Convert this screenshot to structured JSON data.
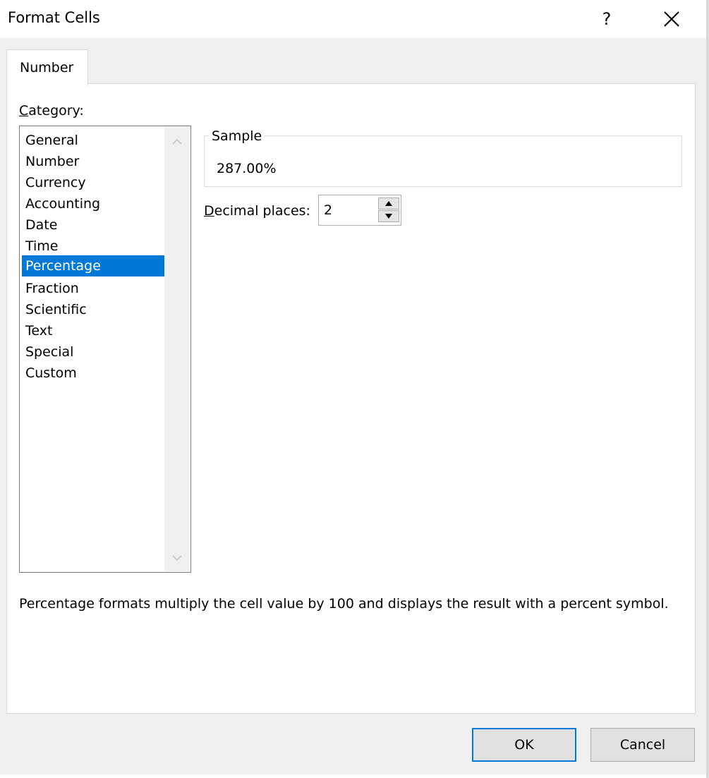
{
  "dialog": {
    "title": "Format Cells",
    "help_label": "?",
    "close_icon": "close-icon"
  },
  "tabs": [
    {
      "label": "Number",
      "active": true
    }
  ],
  "category": {
    "label_underlined": "C",
    "label_rest": "ategory:",
    "items": [
      {
        "label": "General"
      },
      {
        "label": "Number"
      },
      {
        "label": "Currency"
      },
      {
        "label": "Accounting"
      },
      {
        "label": "Date"
      },
      {
        "label": "Time"
      },
      {
        "label": "Percentage",
        "selected": true
      },
      {
        "label": "Fraction"
      },
      {
        "label": "Scientific"
      },
      {
        "label": "Text"
      },
      {
        "label": "Special"
      },
      {
        "label": "Custom"
      }
    ],
    "scroll_up_icon": "chevron-up-icon",
    "scroll_down_icon": "chevron-down-icon"
  },
  "sample": {
    "legend": "Sample",
    "value": "287.00%"
  },
  "decimal_places": {
    "label_underlined": "D",
    "label_rest": "ecimal places:",
    "value": "2",
    "up_icon": "triangle-up-icon",
    "down_icon": "triangle-down-icon"
  },
  "description": "Percentage formats multiply the cell value by 100 and displays the result with a percent symbol.",
  "buttons": {
    "ok_label": "OK",
    "cancel_label": "Cancel"
  },
  "colors": {
    "selection": "#0078d7",
    "dialog_bg": "#f0f0f0",
    "panel_bg": "#ffffff"
  }
}
